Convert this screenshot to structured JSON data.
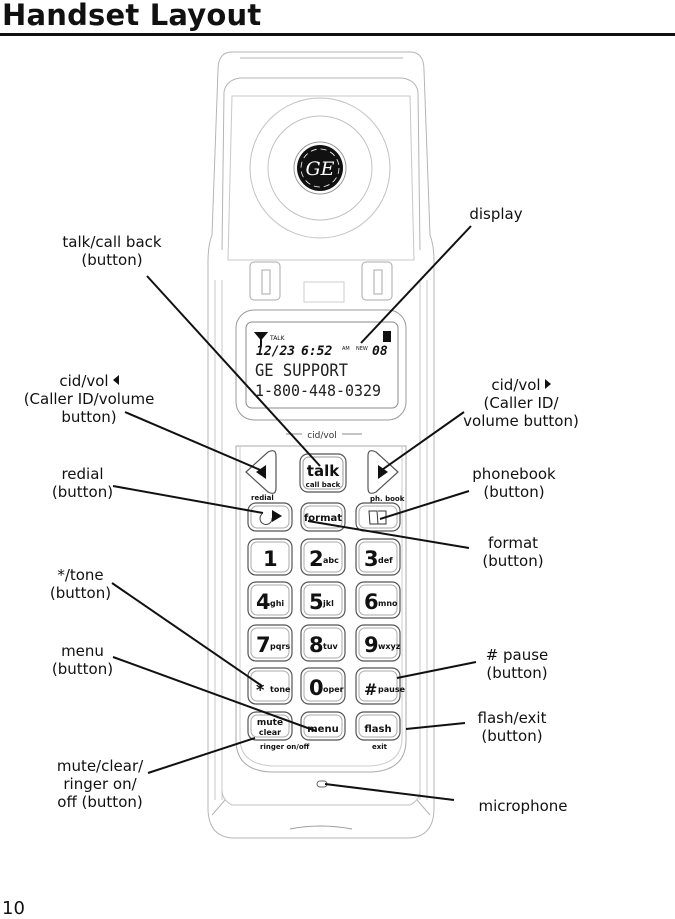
{
  "page": {
    "title": "Handset Layout",
    "number": "10"
  },
  "handset": {
    "brand_logo": "GE",
    "display": {
      "signal_icon": "antenna-icon",
      "status": "TALK",
      "date": "12/23",
      "time": "6:52",
      "ampm": "AM",
      "new_badge": "NEW",
      "count": "08",
      "battery_icon": "battery-icon",
      "line1": "GE SUPPORT",
      "line2": "1-800-448-0329"
    },
    "nav_label": "cid/vol",
    "keys": {
      "talk": "talk",
      "talk_sub": "call back",
      "redial_label": "redial",
      "phbook_label": "ph. book",
      "format": "format",
      "k1": "1",
      "k1_sub": "",
      "k2": "2",
      "k2_sub": "abc",
      "k3": "3",
      "k3_sub": "def",
      "k4": "4",
      "k4_sub": "ghi",
      "k5": "5",
      "k5_sub": "jkl",
      "k6": "6",
      "k6_sub": "mno",
      "k7": "7",
      "k7_sub": "pqrs",
      "k8": "8",
      "k8_sub": "tuv",
      "k9": "9",
      "k9_sub": "wxyz",
      "kstar": "*",
      "kstar_sub": "tone",
      "k0": "0",
      "k0_sub": "oper",
      "khash": "#",
      "khash_sub": "pause",
      "mute": "mute",
      "clear": "clear",
      "ringer_label": "ringer on/off",
      "menu": "menu",
      "flash": "flash",
      "exit_label": "exit"
    }
  },
  "callouts": {
    "talk": [
      "talk/call back",
      "(button)"
    ],
    "cid_left": [
      "cid/vol",
      "(Caller ID/volume",
      "button)"
    ],
    "redial": [
      "redial",
      "(button)"
    ],
    "tone": [
      "*/tone",
      "(button)"
    ],
    "menu": [
      "menu",
      "(button)"
    ],
    "mute": [
      "mute/clear/",
      "ringer on/",
      "off (button)"
    ],
    "display": [
      "display"
    ],
    "cid_right": [
      "cid/vol",
      "(Caller ID/",
      "volume button)"
    ],
    "phonebook": [
      "phonebook",
      "(button)"
    ],
    "format": [
      "format",
      "(button)"
    ],
    "pause": [
      "# pause",
      "(button)"
    ],
    "flash": [
      "flash/exit",
      "(button)"
    ],
    "microphone": [
      "microphone"
    ]
  }
}
